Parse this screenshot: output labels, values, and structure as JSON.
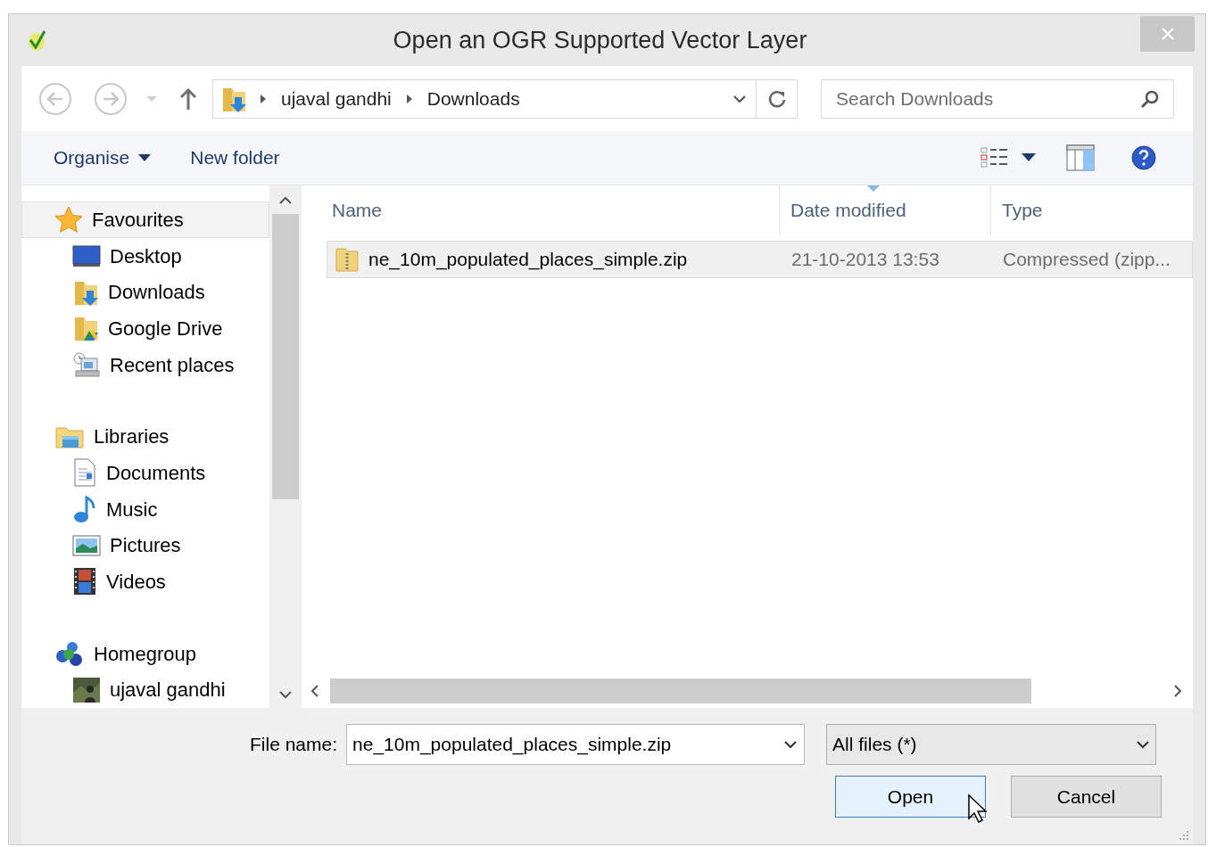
{
  "window": {
    "title": "Open an OGR Supported Vector Layer"
  },
  "address_bar": {
    "path": [
      "ujaval gandhi",
      "Downloads"
    ]
  },
  "search": {
    "placeholder": "Search Downloads"
  },
  "toolbar": [
    {
      "label": "Organise",
      "kind": "menu"
    },
    {
      "label": "New folder",
      "kind": "button"
    }
  ],
  "navigation": [
    {
      "label": "Favourites",
      "kind": "star",
      "selected": true,
      "children": [
        {
          "label": "Desktop",
          "kind": "desktop",
          "selected": false
        },
        {
          "label": "Downloads",
          "kind": "downloads",
          "selected": false
        },
        {
          "label": "Google Drive",
          "kind": "drive",
          "selected": false
        },
        {
          "label": "Recent places",
          "kind": "recent",
          "selected": false
        }
      ]
    },
    {
      "label": "Libraries",
      "kind": "libraries",
      "selected": false,
      "children": [
        {
          "label": "Documents",
          "kind": "documents",
          "selected": false
        },
        {
          "label": "Music",
          "kind": "music",
          "selected": false
        },
        {
          "label": "Pictures",
          "kind": "pictures",
          "selected": false
        },
        {
          "label": "Videos",
          "kind": "videos",
          "selected": false
        }
      ]
    },
    {
      "label": "Homegroup",
      "kind": "homegroup",
      "selected": false,
      "children": [
        {
          "label": "ujaval gandhi",
          "kind": "user",
          "selected": false
        }
      ]
    }
  ],
  "file_list": {
    "columns": [
      {
        "label": "Name",
        "sorted": false
      },
      {
        "label": "Date modified",
        "sorted": true
      },
      {
        "label": "Type",
        "sorted": false
      }
    ],
    "rows": [
      {
        "name": "ne_10m_populated_places_simple.zip",
        "date": "21-10-2013 13:53",
        "type": "Compressed (zipp...",
        "selected": true
      }
    ]
  },
  "file_name": {
    "label": "File name:",
    "value": "ne_10m_populated_places_simple.zip"
  },
  "file_type": {
    "value": "All files (*)"
  },
  "buttons": [
    {
      "label": "Open",
      "default": true
    },
    {
      "label": "Cancel",
      "default": false
    }
  ]
}
